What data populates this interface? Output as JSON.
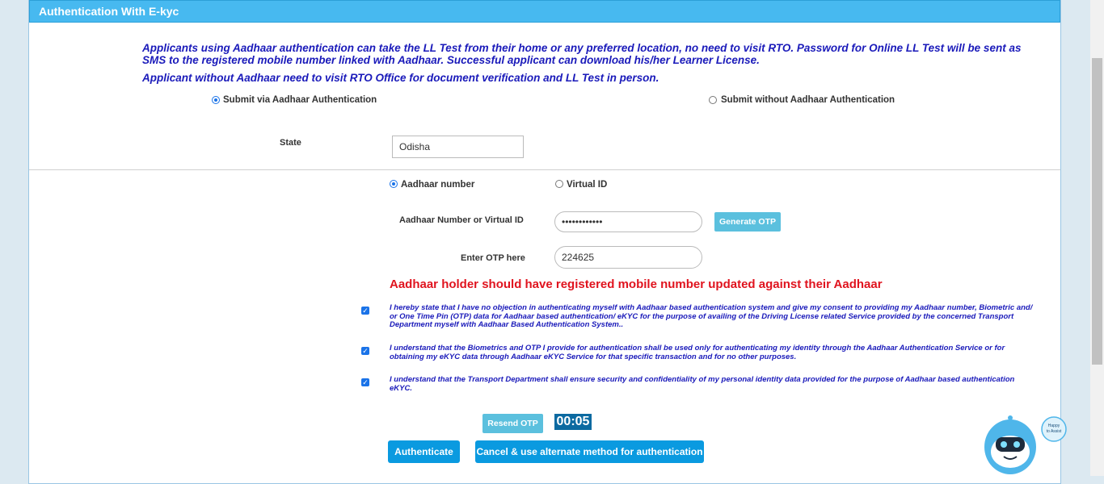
{
  "panel": {
    "title": "Authentication With E-kyc"
  },
  "info": {
    "line1": "Applicants using Aadhaar authentication can take the LL Test from their home or any preferred location, no need to visit RTO. Password for Online LL Test will be sent as SMS to the registered mobile number linked with Aadhaar. Successful applicant can download his/her Learner License.",
    "line2": "Applicant without Aadhaar need to visit RTO Office for document verification and LL Test in person."
  },
  "submit_mode": {
    "via_aadhaar": "Submit via Aadhaar Authentication",
    "without_aadhaar": "Submit without Aadhaar Authentication",
    "selected": "via_aadhaar"
  },
  "state": {
    "label": "State",
    "value": "Odisha"
  },
  "id_type": {
    "aadhaar": "Aadhaar number",
    "virtual": "Virtual ID",
    "selected": "aadhaar"
  },
  "aadhaar_field": {
    "label": "Aadhaar Number or Virtual ID",
    "value": "••••••••••••",
    "generate_label": "Generate OTP"
  },
  "otp_field": {
    "label": "Enter OTP here",
    "value": "224625"
  },
  "warning": "Aadhaar holder should have registered mobile number updated against their Aadhaar",
  "declarations": [
    {
      "checked": true,
      "text": "I hereby state that I have no objection in authenticating myself with Aadhaar based authentication system and give my consent to providing my Aadhaar number, Biometric and/ or One Time Pin (OTP) data for Aadhaar based authentication/ eKYC for the purpose of availing of the Driving License related Service provided by the concerned Transport Department myself with Aadhaar Based Authentication System.."
    },
    {
      "checked": true,
      "text": "I understand that the Biometrics and OTP I provide for authentication shall be used only for authenticating my identity through the Aadhaar Authentication Service or for obtaining my eKYC data through Aadhaar eKYC Service for that specific transaction and for no other purposes."
    },
    {
      "checked": true,
      "text": "I understand that the Transport Department shall ensure security and confidentiality of my personal identity data provided for the purpose of Aadhaar based authentication eKYC."
    }
  ],
  "otp_actions": {
    "resend_label": "Resend OTP",
    "timer": "00:05"
  },
  "actions": {
    "authenticate_label": "Authenticate",
    "cancel_label": "Cancel & use alternate method for authentication"
  },
  "chatbot": {
    "bubble_line1": "Happy",
    "bubble_line2": "to Assist",
    "icon": "robot-icon"
  },
  "colors": {
    "header": "#47b9f0",
    "info_text": "#1a1aba",
    "warning": "#e0131e",
    "primary_button": "#0a9ae0",
    "light_button": "#5bc0de",
    "timer": "#0c6aa1"
  }
}
